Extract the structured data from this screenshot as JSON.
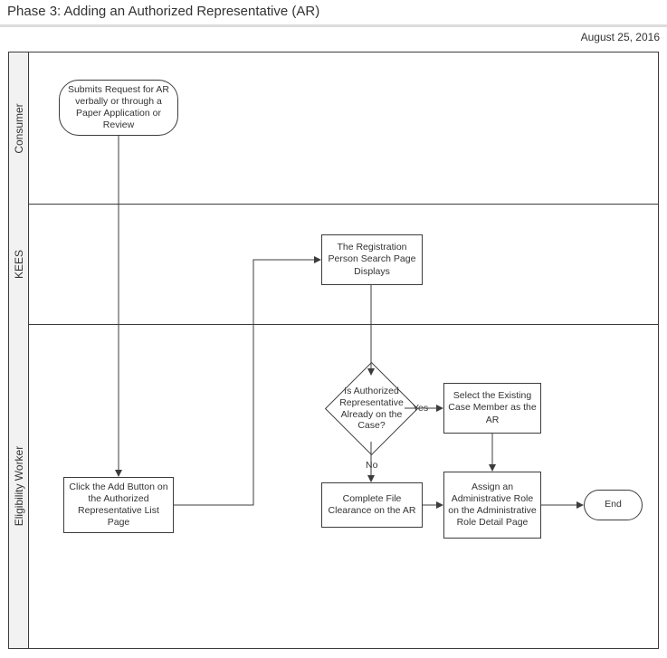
{
  "header": {
    "title": "Phase 3: Adding an Authorized Representative (AR)",
    "date": "August 25, 2016"
  },
  "lanes": {
    "consumer": "Consumer",
    "kees": "KEES",
    "worker": "Eligibility Worker"
  },
  "nodes": {
    "start": "Submits Request for AR verbally or through a Paper Application or Review",
    "reg": "The Registration Person Search Page Displays",
    "decision": "Is Authorized Representative Already on the Case?",
    "selectExisting": "Select the Existing Case Member as the AR",
    "clickAdd": "Click the Add Button on the Authorized Representative List Page",
    "fileClear": "Complete File Clearance on the AR",
    "assign": "Assign an Administrative Role on the Administrative Role Detail Page",
    "end": "End"
  },
  "edges": {
    "yes": "Yes",
    "no": "No"
  }
}
